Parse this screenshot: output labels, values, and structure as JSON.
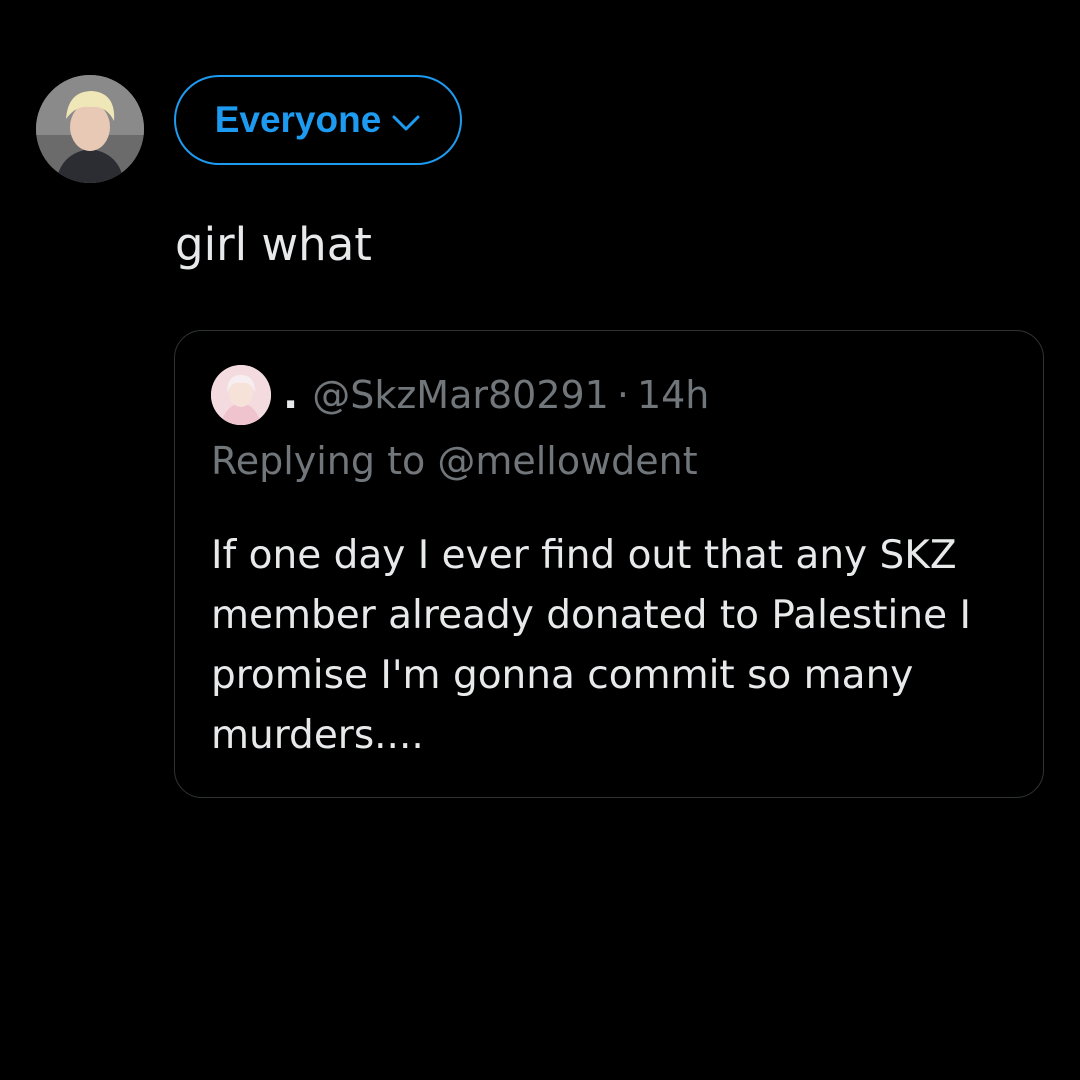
{
  "composer": {
    "avatar_icon": "user-avatar-photo",
    "audience_label": "Everyone",
    "audience_icon": "chevron-down-icon",
    "accent_color": "#1d9bf0",
    "text": "girl what"
  },
  "quoted_tweet": {
    "avatar_icon": "user-avatar-photo",
    "display_name": ".",
    "handle": "@SkzMar80291",
    "separator": "·",
    "time": "14h",
    "replying_prefix": "Replying to ",
    "replying_to": "@mellowdent",
    "body_lines": [
      "If one day I ever find out that any SKZ",
      "member already donated to Palestine I",
      "promise I'm gonna commit so many",
      "murders...."
    ]
  }
}
